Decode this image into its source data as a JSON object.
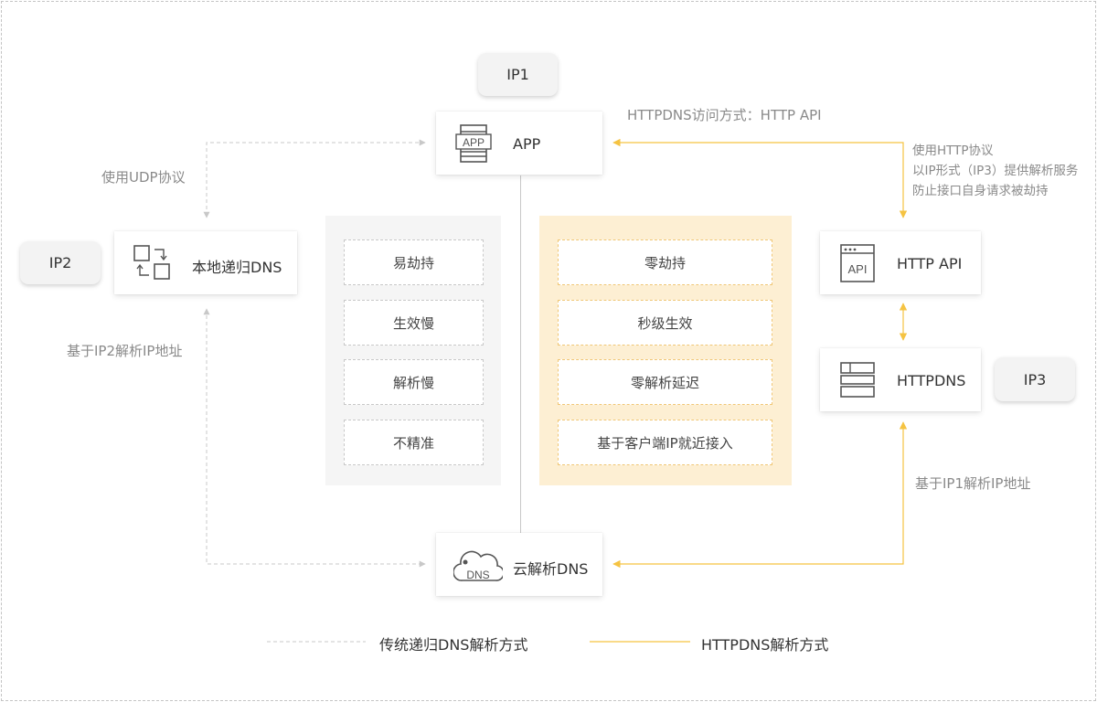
{
  "app": {
    "label": "APP",
    "icon_text": "APP"
  },
  "local_dns": {
    "label": "本地递归DNS"
  },
  "cloud_dns": {
    "label": "云解析DNS",
    "icon_text": "DNS"
  },
  "http_api": {
    "label": "HTTP API",
    "icon_text": "API"
  },
  "httpdns": {
    "label": "HTTPDNS"
  },
  "bubbles": {
    "ip1": "IP1",
    "ip2": "IP2",
    "ip3": "IP3"
  },
  "annotations": {
    "udp": "使用UDP协议",
    "ip2_resolve": "基于IP2解析IP地址",
    "httpdns_access": "HTTPDNS访问方式：HTTP API",
    "http_notes": [
      "使用HTTP协议",
      "以IP形式（IP3）提供解析服务",
      "防止接口自身请求被劫持"
    ],
    "ip1_resolve": "基于IP1解析IP地址"
  },
  "traditional_features": [
    "易劫持",
    "生效慢",
    "解析慢",
    "不精准"
  ],
  "httpdns_features": [
    "零劫持",
    "秒级生效",
    "零解析延迟",
    "基于客户端IP就近接入"
  ],
  "legend": {
    "traditional": "传统递归DNS解析方式",
    "httpdns": "HTTPDNS解析方式"
  },
  "colors": {
    "accent": "#f5c342",
    "dashed_gray": "#c8c8c8",
    "panel_yellow": "#fdefd3",
    "panel_gray": "#f5f5f5",
    "annotation_text": "#8a8a8a"
  }
}
